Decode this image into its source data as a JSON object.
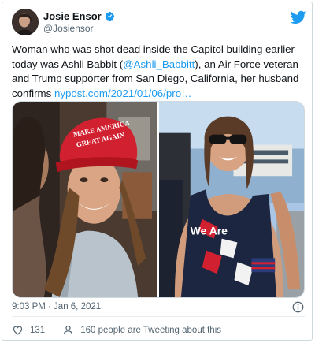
{
  "tweet": {
    "author": {
      "display_name": "Josie Ensor",
      "handle": "@Josiensor",
      "verified": true
    },
    "text_before_mention": "Woman who was shot dead inside the Capitol building earlier today was Ashli Babbit (",
    "mention": "@Ashli_Babbitt",
    "text_after_mention": "), an Air Force veteran and Trump supporter from San Diego, California, her husband confirms ",
    "link": "nypost.com/2021/01/06/pro…",
    "media": {
      "left_photo": {
        "hat_text_line1": "MAKE AMERICA",
        "hat_text_line2": "GREAT AGAIN"
      },
      "right_photo": {
        "shirt_text": "We Are"
      }
    },
    "timestamp": "9:03 PM · Jan 6, 2021",
    "likes_count": "131",
    "retweet_text": "160 people are Tweeting about this"
  },
  "icons": {
    "brand": "twitter-bird-icon",
    "verified": "verified-badge-icon",
    "info": "info-icon",
    "like": "heart-icon",
    "retweet": "people-icon"
  },
  "colors": {
    "accent": "#1d9bf0",
    "text": "#0f1419",
    "secondary": "#536471",
    "border": "#cfd9de",
    "hat_red": "#d1202f"
  }
}
